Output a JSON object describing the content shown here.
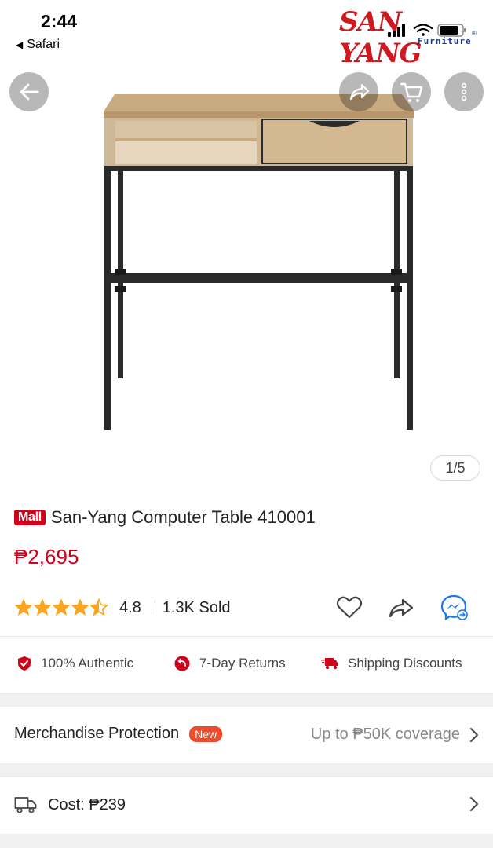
{
  "status_bar": {
    "time": "2:44",
    "back_app_label": "Safari"
  },
  "brand": {
    "name": "SAN YANG",
    "sub": "Furniture",
    "reg": "®"
  },
  "hero": {
    "page_counter": "1/5"
  },
  "product": {
    "mall_badge": "Mall",
    "title": "San-Yang Computer Table 410001",
    "price": "₱2,695",
    "rating": "4.8",
    "rating_stars": 4.5,
    "sold": "1.3K Sold"
  },
  "guarantees": [
    {
      "icon": "shield-check-icon",
      "label": "100% Authentic"
    },
    {
      "icon": "return-icon",
      "label": "7-Day Returns"
    },
    {
      "icon": "truck-icon",
      "label": "Shipping Discounts"
    }
  ],
  "protection": {
    "label": "Merchandise Protection",
    "badge": "New",
    "coverage": "Up to ₱50K coverage"
  },
  "shipping": {
    "label": "Cost: ₱239"
  },
  "colors": {
    "accent_red": "#d0011b",
    "orange": "#ee4d2d",
    "messenger_blue": "#1877f2",
    "star": "#f6a623"
  }
}
